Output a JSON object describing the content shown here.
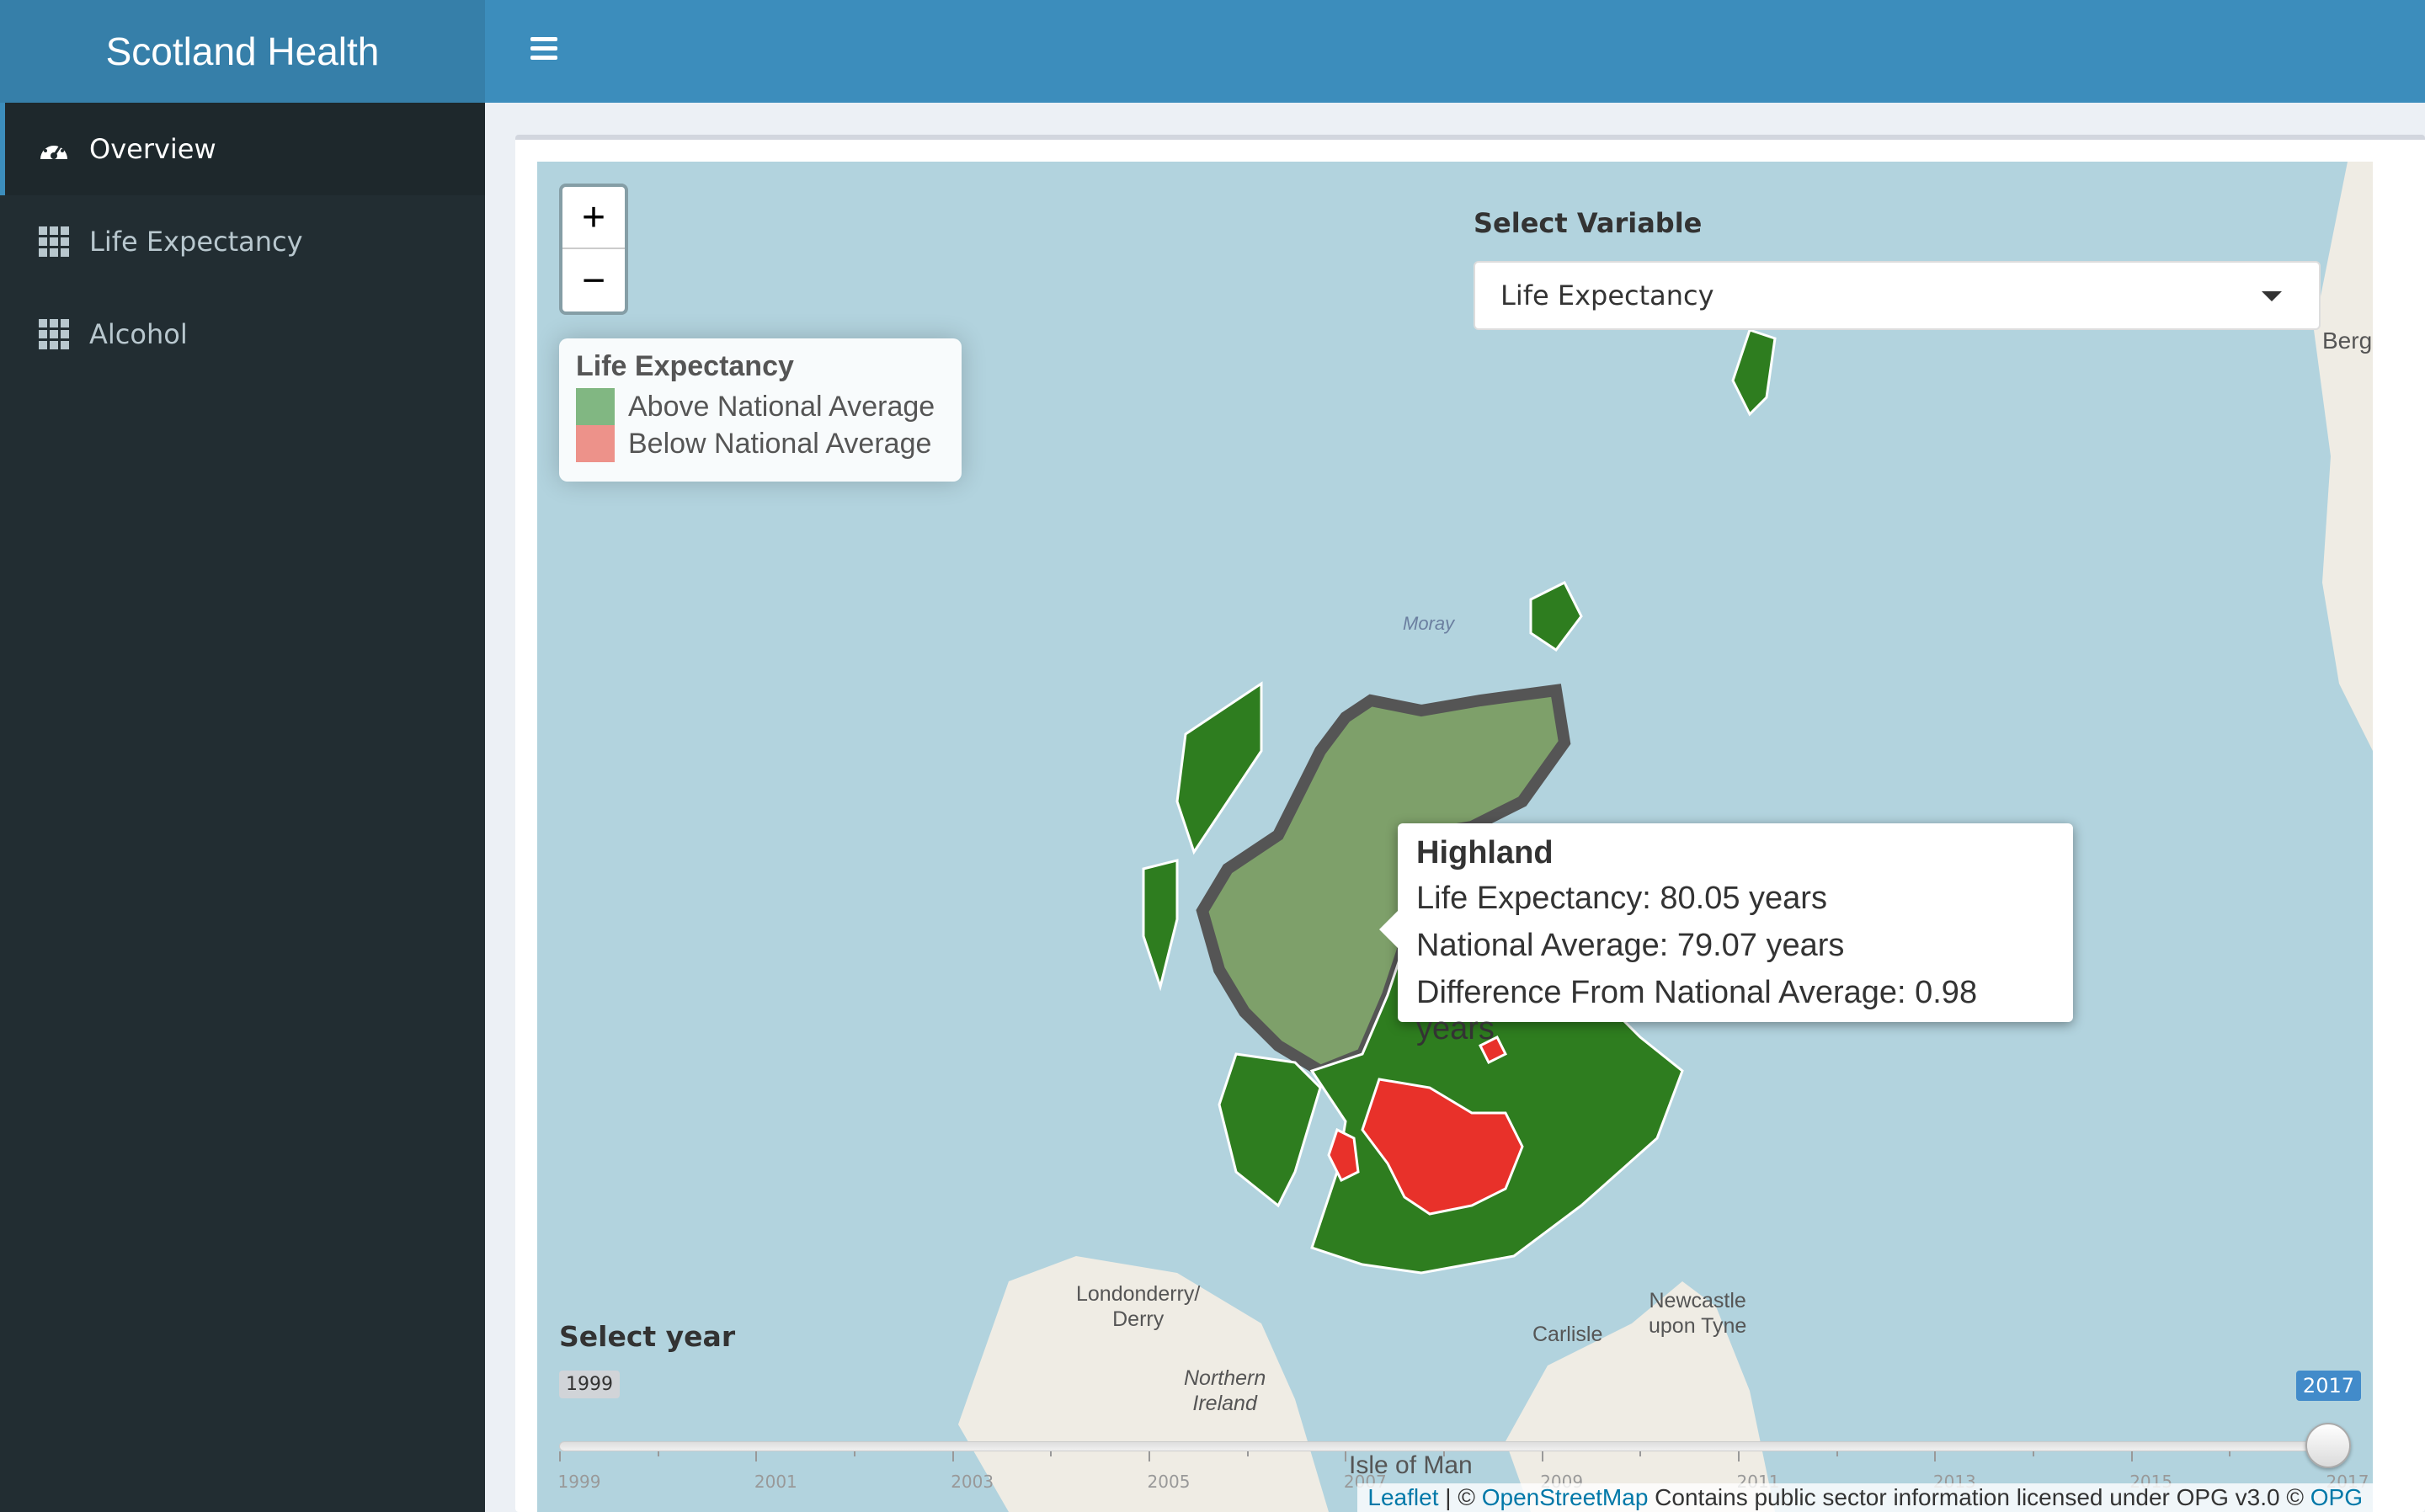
{
  "app": {
    "title": "Scotland Health"
  },
  "sidebar": {
    "items": [
      {
        "label": "Overview",
        "icon": "dashboard-icon",
        "active": true
      },
      {
        "label": "Life Expectancy",
        "icon": "grid-icon",
        "active": false
      },
      {
        "label": "Alcohol",
        "icon": "grid-icon",
        "active": false
      }
    ]
  },
  "map": {
    "zoom_in": "+",
    "zoom_out": "−",
    "legend": {
      "title": "Life Expectancy",
      "items": [
        {
          "label": "Above National Average",
          "color": "#4f9a4f"
        },
        {
          "label": "Below National Average",
          "color": "#e8655a"
        }
      ]
    },
    "variable": {
      "label": "Select Variable",
      "value": "Life Expectancy"
    },
    "popup": {
      "title": "Highland",
      "lines": [
        "Life Expectancy: 80.05 years",
        "National Average: 79.07 years",
        "Difference From National Average: 0.98 years"
      ]
    },
    "place_labels": {
      "londonderry": "Londonderry/\nDerry",
      "northern_ireland": "Northern\nIreland",
      "newcastle": "Newcastle\nupon Tyne",
      "carlisle": "Carlisle",
      "isle_of_man": "Isle of Man",
      "bergen": "Berg",
      "moray": "Moray"
    },
    "attribution": {
      "leaflet": "Leaflet",
      "sep": " | © ",
      "osm": "OpenStreetMap",
      "text": " Contains public sector information licensed under OPG v3.0 © ",
      "opg": "OPG"
    }
  },
  "slider": {
    "label": "Select year",
    "min": "1999",
    "max": "2017",
    "value": 2017,
    "tick_labels": [
      "1999",
      "2001",
      "2003",
      "2005",
      "2007",
      "2009",
      "2011",
      "2013",
      "2015",
      "2017"
    ]
  },
  "colors": {
    "above": "#2e7d1f",
    "below": "#e8312a",
    "highlight": "#6f9a5c",
    "accent": "#3c8dbc"
  }
}
